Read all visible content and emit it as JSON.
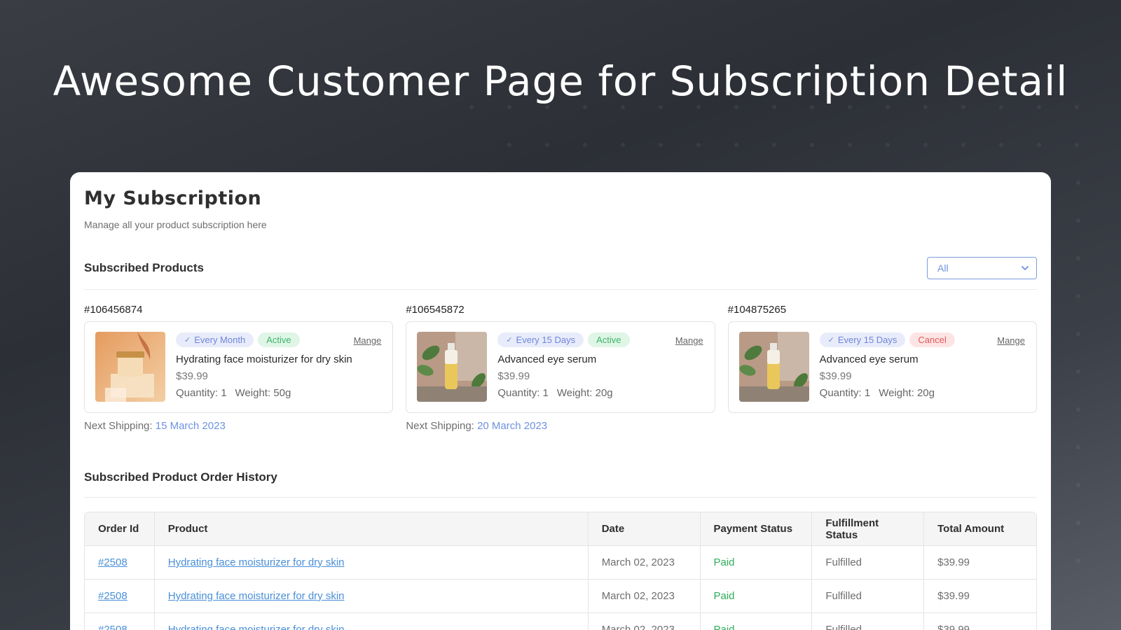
{
  "hero": {
    "title": "Awesome Customer Page for Subscription Detail"
  },
  "page": {
    "title": "My Subscription",
    "subtitle": "Manage all your product subscription here"
  },
  "subscribed": {
    "title": "Subscribed Products",
    "filter": {
      "selected": "All"
    },
    "items": [
      {
        "id": "#106456874",
        "frequency": "Every Month",
        "status": "Active",
        "status_kind": "active",
        "manage_label": "Mange",
        "name": "Hydrating face moisturizer for dry skin",
        "price": "$39.99",
        "quantity": "Quantity: 1",
        "weight": "Weight: 50g",
        "next_label": "Next Shipping:",
        "next_date": "15 March 2023",
        "image": "cream-jar"
      },
      {
        "id": "#106545872",
        "frequency": "Every 15 Days",
        "status": "Active",
        "status_kind": "active",
        "manage_label": "Mange",
        "name": "Advanced eye serum",
        "price": "$39.99",
        "quantity": "Quantity: 1",
        "weight": "Weight: 20g",
        "next_label": "Next Shipping:",
        "next_date": "20 March 2023",
        "image": "serum-bottle"
      },
      {
        "id": "#104875265",
        "frequency": "Every 15 Days",
        "status": "Cancel",
        "status_kind": "cancel",
        "manage_label": "Mange",
        "name": "Advanced eye serum",
        "price": "$39.99",
        "quantity": "Quantity: 1",
        "weight": "Weight: 20g",
        "next_label": "",
        "next_date": "",
        "image": "serum-bottle"
      }
    ]
  },
  "history": {
    "title": "Subscribed Product Order History",
    "columns": [
      "Order Id",
      "Product",
      "Date",
      "Payment Status",
      "Fulfillment Status",
      "Total Amount"
    ],
    "rows": [
      {
        "order_id": "#2508",
        "product": "Hydrating face moisturizer for dry skin",
        "date": "March 02, 2023",
        "payment": "Paid",
        "fulfillment": "Fulfilled",
        "total": "$39.99"
      },
      {
        "order_id": "#2508",
        "product": "Hydrating face moisturizer for dry skin",
        "date": "March 02, 2023",
        "payment": "Paid",
        "fulfillment": "Fulfilled",
        "total": "$39.99"
      },
      {
        "order_id": "#2508",
        "product": "Hydrating face moisturizer for dry skin",
        "date": "March 02, 2023",
        "payment": "Paid",
        "fulfillment": "Fulfilled",
        "total": "$39.99"
      }
    ]
  },
  "colors": {
    "accent": "#6f92e0",
    "link": "#4a8fd8",
    "active": "#3fb56b",
    "cancel": "#e05a5a",
    "paid": "#2fae5a"
  }
}
